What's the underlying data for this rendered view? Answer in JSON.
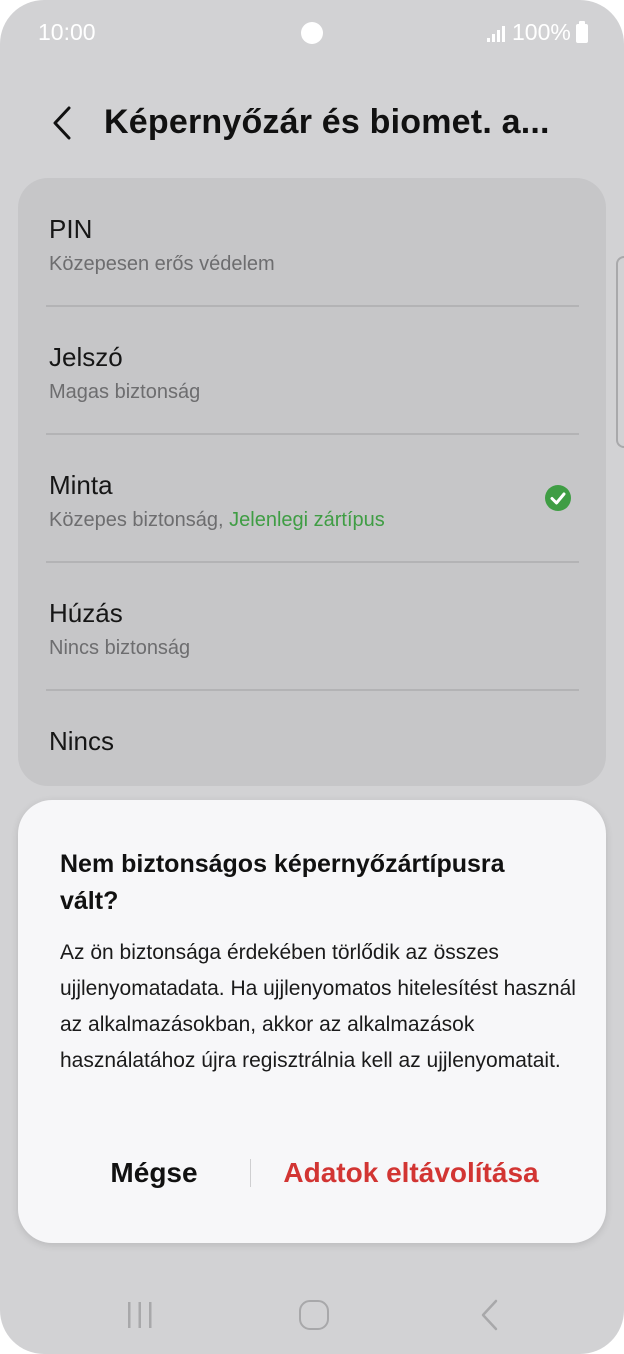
{
  "status_bar": {
    "time": "10:00",
    "battery": "100%",
    "icons": [
      "camera-dot",
      "signal-icon",
      "battery-icon"
    ]
  },
  "header": {
    "back_icon": "chevron-left-icon",
    "title": "Képernyőzár és biomet. a..."
  },
  "options": [
    {
      "title": "PIN",
      "subtitle": "Közepesen erős védelem"
    },
    {
      "title": "Jelszó",
      "subtitle": "Magas biztonság"
    },
    {
      "title": "Minta",
      "subtitle": "Közepes biztonság,",
      "current_label": "Jelenlegi zártípus",
      "selected_icon": "check-circle-icon"
    },
    {
      "title": "Húzás",
      "subtitle": "Nincs biztonság"
    },
    {
      "title": "Nincs"
    }
  ],
  "dialog": {
    "title": "Nem biztonságos képernyőzártípusra vált?",
    "body": "Az ön biztonsága érdekében törlődik az összes ujjlenyomatadata. Ha ujjlenyomatos hitelesítést használ az alkalmazásokban, akkor az alkalmazások használatához újra regisztrálnia kell az ujjlenyomatait.",
    "cancel_label": "Mégse",
    "confirm_label": "Adatok eltávolítása"
  },
  "nav_bar": {
    "icons": [
      "recents-icon",
      "home-icon",
      "back-icon"
    ]
  },
  "colors": {
    "accent_green": "#3f9d44",
    "destructive_red": "#d23533",
    "dim_background": "#d2d2d4"
  }
}
